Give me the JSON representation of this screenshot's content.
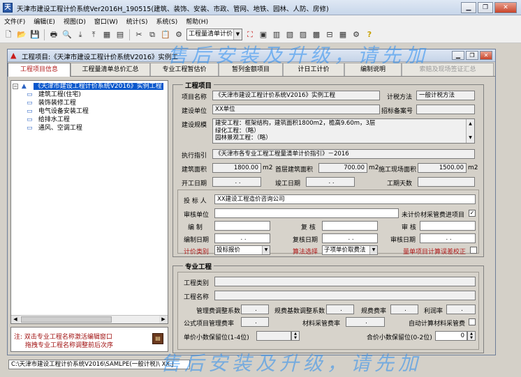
{
  "window": {
    "title": "天津市建设工程计价系统Ver2016H_190515(建筑、装饰、安装、市政、管网、地铁、园林、人防、房修)"
  },
  "menu": [
    "文件(F)",
    "编辑(E)",
    "视图(D)",
    "窗口(W)",
    "统计(S)",
    "系统(S)",
    "帮助(H)"
  ],
  "toolbar": {
    "mode_select": "工程量清单计价"
  },
  "doc_window": {
    "title": "工程项目:《天津市建设工程计价系统V2016》实例工"
  },
  "tabs": [
    {
      "label": "工程项目信息",
      "active": true
    },
    {
      "label": "工程量清单总价汇总"
    },
    {
      "label": "专业工程暂估价"
    },
    {
      "label": "暂列金额项目"
    },
    {
      "label": "计日工计价"
    },
    {
      "label": "编制说明"
    },
    {
      "label": "索赔及现场签证汇总",
      "disabled": true
    }
  ],
  "tree": {
    "root": "《天津市建设工程计价系统V2016》实例工程",
    "children": [
      "建筑工程(住宅)",
      "装饰装修工程",
      "电气设备安装工程",
      "给排水工程",
      "通风、空调工程"
    ]
  },
  "note": {
    "line1": "注: 双击专业工程名称激活编辑窗口",
    "line2": "拖拽专业工程名称调整前后次序",
    "book_icon": "book-icon"
  },
  "project": {
    "group_title": "工程项目",
    "name_label": "项目名称",
    "name_value": "《天津市建设工程计价系统V2016》实例工程",
    "tax_method_label": "计税方法",
    "tax_method_value": "一般计税方法",
    "unit_label": "建设单位",
    "unit_value": "XX单位",
    "bid_no_label": "招标备案号",
    "bid_no_value": "",
    "scale_label": "建设规模",
    "scale_lines": [
      "建安工程：框架结构，建筑面积1800m2，檐高9.60m，3层",
      "绿化工程：（略）",
      "园林景观工程：（略）"
    ],
    "guide_label": "执行指引",
    "guide_value": "《天津市各专业工程工程量清单计价指引》－2016",
    "area_label": "建筑面积",
    "area_value": "1800.00",
    "area_unit": "m2",
    "first_floor_label": "首层建筑面积",
    "first_floor_value": "700.00",
    "first_floor_unit": "m2",
    "site_area_label": "施工现场面积",
    "site_area_value": "1500.00",
    "site_area_unit": "m2",
    "start_label": "开工日期",
    "start_value": ". .",
    "end_label": "竣工日期",
    "end_value": ". .",
    "days_label": "工期天数",
    "days_value": ""
  },
  "bidder": {
    "bidder_label": "投 标 人",
    "bidder_value": "XX建设工程造价咨询公司",
    "audit_unit_label": "审核单位",
    "audit_unit_value": "",
    "material_check_label": "未计价材采管费进项目",
    "material_checked": "✓",
    "compile_label": "编 制",
    "review_label": "复 核",
    "audit_label": "审 核",
    "compile_date_label": "编制日期",
    "compile_date_value": ". .",
    "review_date_label": "复核日期",
    "review_date_value": ". .",
    "audit_date_label": "审核日期",
    "audit_date_value": ". .",
    "price_type_label": "计价类别",
    "price_type_value": "投标报价",
    "algorithm_label": "算法选择",
    "algorithm_value": "子项单价取费法",
    "bq_error_label": "量单项目计算误差校正"
  },
  "specialty": {
    "group_title": "专业工程",
    "type_label": "工程类别",
    "type_value": "",
    "name_label": "工程名称",
    "name_value": "",
    "mgmt_coef_label": "管理费调整系数",
    "mgmt_coef_value": ".",
    "fee_base_coef_label": "规费基数调整系数",
    "fee_base_coef_value": ".",
    "fee_rate_label": "规费费率",
    "fee_rate_value": ".",
    "profit_label": "利润率",
    "profit_value": ".",
    "common_mgmt_label": "公式项目管理费率",
    "common_mgmt_value": ".",
    "material_rate_label": "材料采管费率",
    "material_rate_value": ".",
    "auto_material_label": "自动计算材料采管费",
    "unit_decimal_label": "单价小数保留位(1-4位)",
    "unit_decimal_value": "",
    "total_decimal_label": "合价小数保留位(0-2位)",
    "total_decimal_value": "0"
  },
  "status": {
    "path": "C:\\天津市建设工程计价系统V2016\\SAMLPE(一般计税)\\ XX.J"
  },
  "watermark": "售后安装及升级，请先加"
}
